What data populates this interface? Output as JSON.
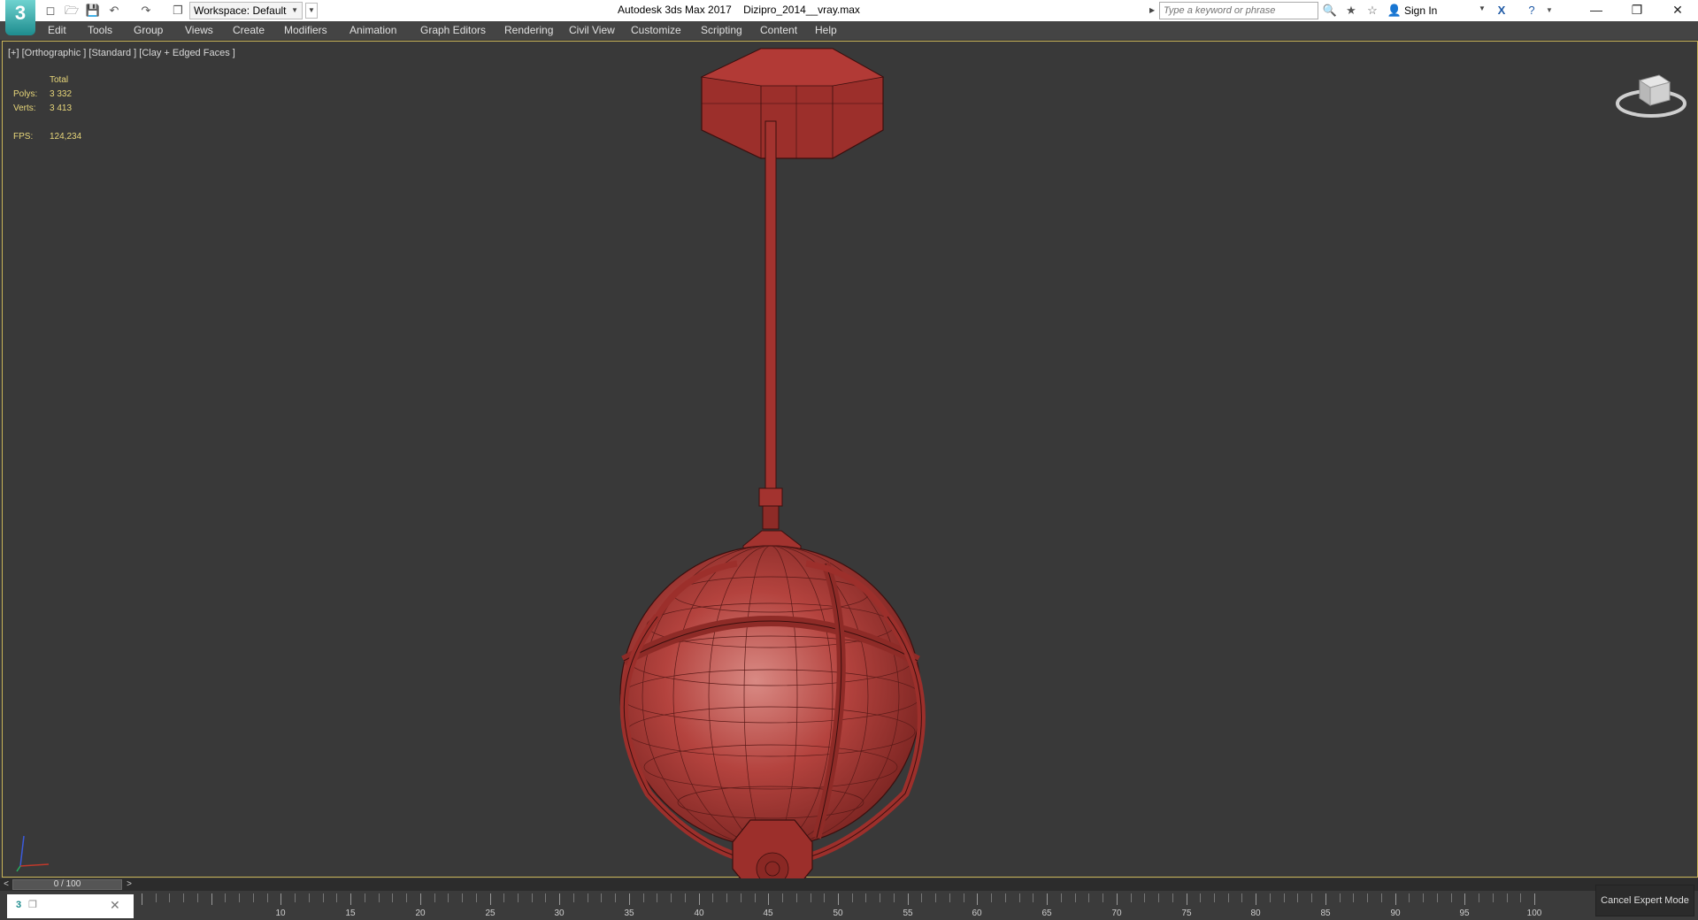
{
  "app": {
    "title": "Autodesk 3ds Max 2017    Dizipro_2014__vray.max",
    "logo_text": "3"
  },
  "quick_access": {
    "workspace_label": "Workspace: Default",
    "icons": [
      "new-file-icon",
      "open-file-icon",
      "save-icon",
      "undo-icon",
      "redo-icon",
      "project-folder-icon"
    ]
  },
  "search": {
    "placeholder": "Type a keyword or phrase"
  },
  "account": {
    "signin_label": "Sign In"
  },
  "menu": {
    "items": [
      "Edit",
      "Tools",
      "Group",
      "Views",
      "Create",
      "Modifiers",
      "Animation",
      "Graph Editors",
      "Rendering",
      "Civil View",
      "Customize",
      "Scripting",
      "Content",
      "Help"
    ]
  },
  "viewport": {
    "label": "[+] [Orthographic ] [Standard ] [Clay + Edged Faces ]",
    "stats": {
      "total_label": "Total",
      "polys_label": "Polys:",
      "polys_value": "3 332",
      "verts_label": "Verts:",
      "verts_value": "3 413",
      "fps_label": "FPS:",
      "fps_value": "124,234"
    },
    "model_color": "#b4433e",
    "border_color": "#c9b458"
  },
  "timeline": {
    "frame_display": "0 / 100",
    "prev_label": "<",
    "next_label": ">",
    "tick_labels": [
      "10",
      "15",
      "20",
      "25",
      "30",
      "35",
      "40",
      "45",
      "50",
      "55",
      "60",
      "65",
      "70",
      "75",
      "80",
      "85",
      "90",
      "95",
      "100"
    ]
  },
  "status": {
    "cancel_expert_label": "Cancel Expert Mode"
  }
}
